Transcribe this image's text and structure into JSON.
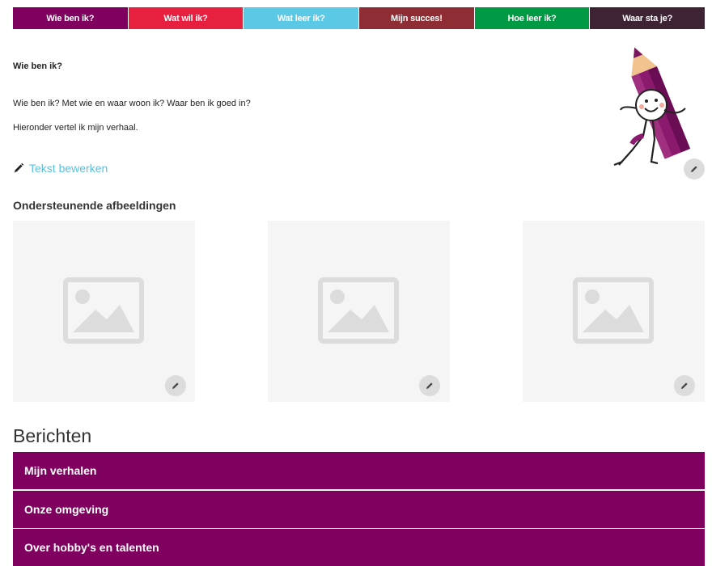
{
  "nav": {
    "tabs": [
      {
        "label": "Wie ben ik?",
        "color": "#800060"
      },
      {
        "label": "Wat wil ik?",
        "color": "#e8203f"
      },
      {
        "label": "Wat leer ik?",
        "color": "#5bc8e6"
      },
      {
        "label": "Mijn succes!",
        "color": "#8f2d34"
      },
      {
        "label": "Hoe leer ik?",
        "color": "#009a44"
      },
      {
        "label": "Waar sta je?",
        "color": "#3e2335"
      }
    ]
  },
  "intro": {
    "heading": "Wie ben ik?",
    "line1": "Wie ben ik? Met wie en waar woon ik? Waar ben ik goed in?",
    "line2": "Hieronder vertel ik mijn verhaal.",
    "edit_label": "Tekst bewerken",
    "edit_link_color": "#5bc0de",
    "icons": [
      "pencil-icon",
      "edit-icon",
      "image-placeholder-icon"
    ]
  },
  "images": {
    "title": "Ondersteunende afbeeldingen"
  },
  "messages": {
    "title": "Berichten",
    "accent": "#800060",
    "items": [
      {
        "label": "Mijn verhalen"
      },
      {
        "label": "Onze omgeving"
      },
      {
        "label": "Over hobby's en talenten"
      }
    ]
  }
}
